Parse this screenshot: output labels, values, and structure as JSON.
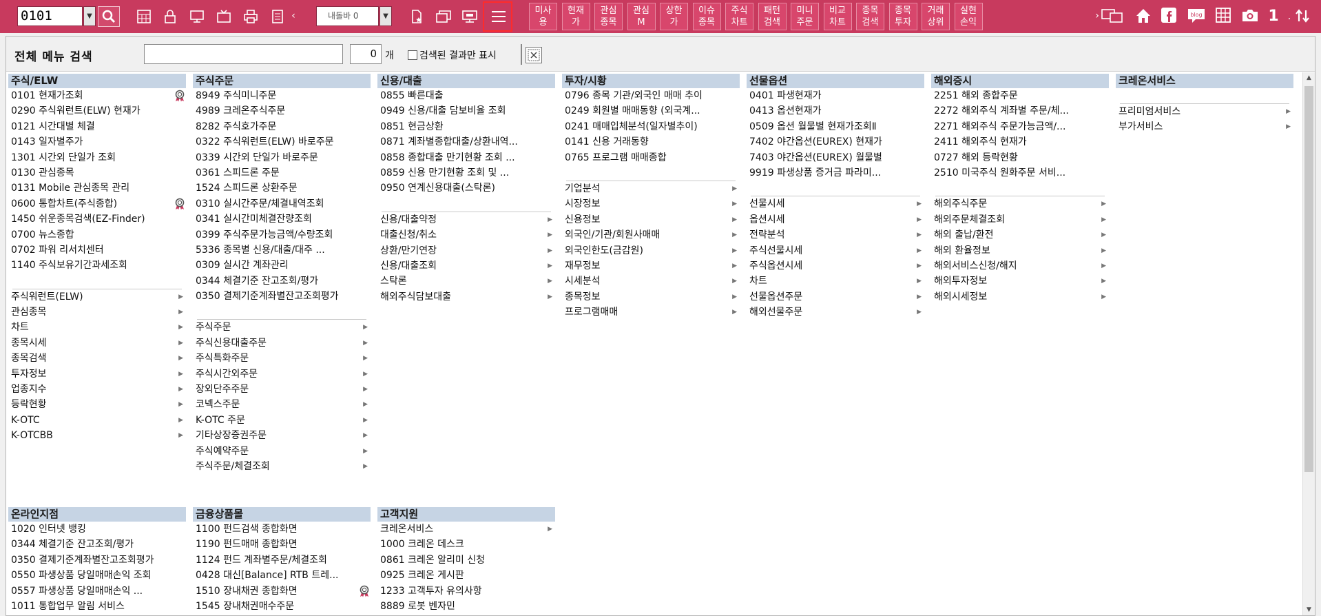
{
  "toolbar": {
    "code_value": "0101",
    "nav_placeholder": "내돌바 0",
    "quick_buttons": [
      [
        "미사",
        "용"
      ],
      [
        "현재",
        "가"
      ],
      [
        "관심",
        "종목"
      ],
      [
        "관심",
        "M"
      ],
      [
        "상한",
        "가"
      ],
      [
        "이슈",
        "종목"
      ],
      [
        "주식",
        "차트"
      ],
      [
        "패턴",
        "검색"
      ],
      [
        "미니",
        "주문"
      ],
      [
        "비교",
        "차트"
      ],
      [
        "종목",
        "검색"
      ],
      [
        "종목",
        "투자"
      ],
      [
        "거래",
        "상위"
      ],
      [
        "실현",
        "손익"
      ]
    ],
    "right_icons": [
      "remote-icon",
      "home-icon",
      "facebook-icon",
      "blog-icon",
      "grid-icon",
      "camera-icon",
      "one-icon",
      "swap-icon"
    ]
  },
  "search": {
    "title": "전체 메뉴 검색",
    "count": "0",
    "count_unit": "개",
    "checkbox_label": "검색된 결과만 표시"
  },
  "columns": [
    {
      "header": "주식/ELW",
      "items": [
        {
          "text": "0101 현재가조회",
          "medal": true
        },
        {
          "text": "0290 주식워런트(ELW) 현재가"
        },
        {
          "text": "0121 시간대별 체결"
        },
        {
          "text": "0143 일자별주가"
        },
        {
          "text": "1301 시간외 단일가 조회"
        },
        {
          "text": "0130 관심종목"
        },
        {
          "text": "0131 Mobile 관심종목 관리"
        },
        {
          "text": "0600 통합차트(주식종합)",
          "medal": true
        },
        {
          "text": "1450 쉬운종목검색(EZ-Finder)"
        },
        {
          "text": "0700 뉴스종합"
        },
        {
          "text": "0702 파워 리서치센터"
        },
        {
          "text": "1140 주식보유기간과세조회"
        }
      ],
      "submenus": [
        "주식워런트(ELW)",
        "관심종목",
        "차트",
        "종목시세",
        "종목검색",
        "투자정보",
        "업종지수",
        "등락현황",
        "K-OTC",
        "K-OTCBB"
      ]
    },
    {
      "header": "주식주문",
      "items": [
        {
          "text": "8949 주식미니주문"
        },
        {
          "text": "4989 크레온주식주문"
        },
        {
          "text": "8282 주식호가주문"
        },
        {
          "text": "0322 주식워런트(ELW) 바로주문"
        },
        {
          "text": "0339 시간외 단일가 바로주문"
        },
        {
          "text": "0361 스피드론 주문"
        },
        {
          "text": "1524 스피드론 상환주문"
        },
        {
          "text": "0310 실시간주문/체결내역조회"
        },
        {
          "text": "0341 실시간미체결잔량조회"
        },
        {
          "text": "0399 주식주문가능금액/수량조회"
        },
        {
          "text": "5336 종목별 신용/대출/대주 ..."
        },
        {
          "text": "0309 실시간 계좌관리"
        },
        {
          "text": "0344 체결기준 잔고조회/평가"
        },
        {
          "text": "0350 결제기준계좌별잔고조회평가"
        }
      ],
      "submenus": [
        "주식주문",
        "주식신용대출주문",
        "주식특화주문",
        "주식시간외주문",
        "장외단주주문",
        "코넥스주문",
        "K-OTC 주문",
        "기타상장증권주문",
        "주식예약주문",
        "주식주문/체결조회"
      ]
    },
    {
      "header": "신용/대출",
      "items": [
        {
          "text": "0855 빠른대출"
        },
        {
          "text": "0949 신용/대출 담보비율 조회"
        },
        {
          "text": "0851 현금상환"
        },
        {
          "text": "0871 계좌별종합대출/상환내역..."
        },
        {
          "text": "0858 종합대출 만기현황 조회 ..."
        },
        {
          "text": "0859 신용 만기현황 조회 및 ..."
        },
        {
          "text": "0950 연계신용대출(스탁론)"
        }
      ],
      "submenus": [
        "신용/대출약정",
        "대출신청/취소",
        "상환/만기연장",
        "신용/대출조회",
        "스탁론",
        "해외주식담보대출"
      ]
    },
    {
      "header": "투자/시황",
      "items": [
        {
          "text": "0796 종목 기관/외국인 매매 추이"
        },
        {
          "text": "0249 회원별 매매동향 (외국계..."
        },
        {
          "text": "0241 매매입체분석(일자별추이)"
        },
        {
          "text": "0141 신용 거래동향"
        },
        {
          "text": "0765 프로그램 매매종합"
        }
      ],
      "submenus": [
        "기업분석",
        "시장정보",
        "신용정보",
        "외국인/기관/회원사매매",
        "외국인한도(금감원)",
        "재무정보",
        "시세분석",
        "종목정보",
        "프로그램매매"
      ]
    },
    {
      "header": "선물옵션",
      "items": [
        {
          "text": "0401 파생현재가"
        },
        {
          "text": "0413 옵션현재가"
        },
        {
          "text": "0509 옵션 월물별 현재가조회Ⅱ"
        },
        {
          "text": "7402 야간옵션(EUREX) 현재가"
        },
        {
          "text": "7403 야간옵션(EUREX) 월물별"
        },
        {
          "text": "9919 파생상품 증거금 파라미..."
        }
      ],
      "submenus": [
        "선물시세",
        "옵션시세",
        "전략분석",
        "주식선물시세",
        "주식옵션시세",
        "차트",
        "선물옵션주문",
        "해외선물주문"
      ]
    },
    {
      "header": "해외증시",
      "items": [
        {
          "text": "2251 해외 종합주문"
        },
        {
          "text": "2272 해외주식 계좌별 주문/체..."
        },
        {
          "text": "2271 해외주식 주문가능금액/..."
        },
        {
          "text": "2411 해외주식 현재가"
        },
        {
          "text": "0727 해외 등락현황"
        },
        {
          "text": "2510 미국주식 원화주문 서비..."
        }
      ],
      "submenus": [
        "해외주식주문",
        "해외주문체결조회",
        "해외 출납/환전",
        "해외 환율정보",
        "해외서비스신청/해지",
        "해외투자정보",
        "해외시세정보"
      ]
    },
    {
      "header": "크레온서비스",
      "items": [],
      "submenus": [
        "프리미엄서비스",
        "부가서비스"
      ]
    }
  ],
  "bottom_columns": [
    {
      "header": "온라인지점",
      "items": [
        {
          "text": "1020 인터넷 뱅킹"
        },
        {
          "text": "0344 체결기준 잔고조회/평가"
        },
        {
          "text": "0350 결제기준계좌별잔고조회평가"
        },
        {
          "text": "0550 파생상품 당일매매손익 조회"
        },
        {
          "text": "0557 파생상품 당일매매손익 ..."
        },
        {
          "text": "1011 통합업무 알림 서비스"
        }
      ]
    },
    {
      "header": "금융상품몰",
      "items": [
        {
          "text": "1100 펀드검색 종합화면"
        },
        {
          "text": "1190 펀드매매 종합화면"
        },
        {
          "text": "1124 펀드 계좌별주문/체결조회"
        },
        {
          "text": "0428 대신[Balance] RTB 트레..."
        },
        {
          "text": "1510 장내채권 종합화면",
          "medal": true
        },
        {
          "text": "1545 장내채권매수주문"
        }
      ]
    },
    {
      "header": "고객지원",
      "items": [
        {
          "text": "크레온서비스",
          "arrow": true
        },
        {
          "text": "1000 크레온 데스크"
        },
        {
          "text": "0861 크레온 알리미 신청"
        },
        {
          "text": "0925 크레온 게시판"
        },
        {
          "text": "1233 고객투자 유의사항"
        },
        {
          "text": "8889 로봇 벤자민"
        }
      ]
    }
  ]
}
